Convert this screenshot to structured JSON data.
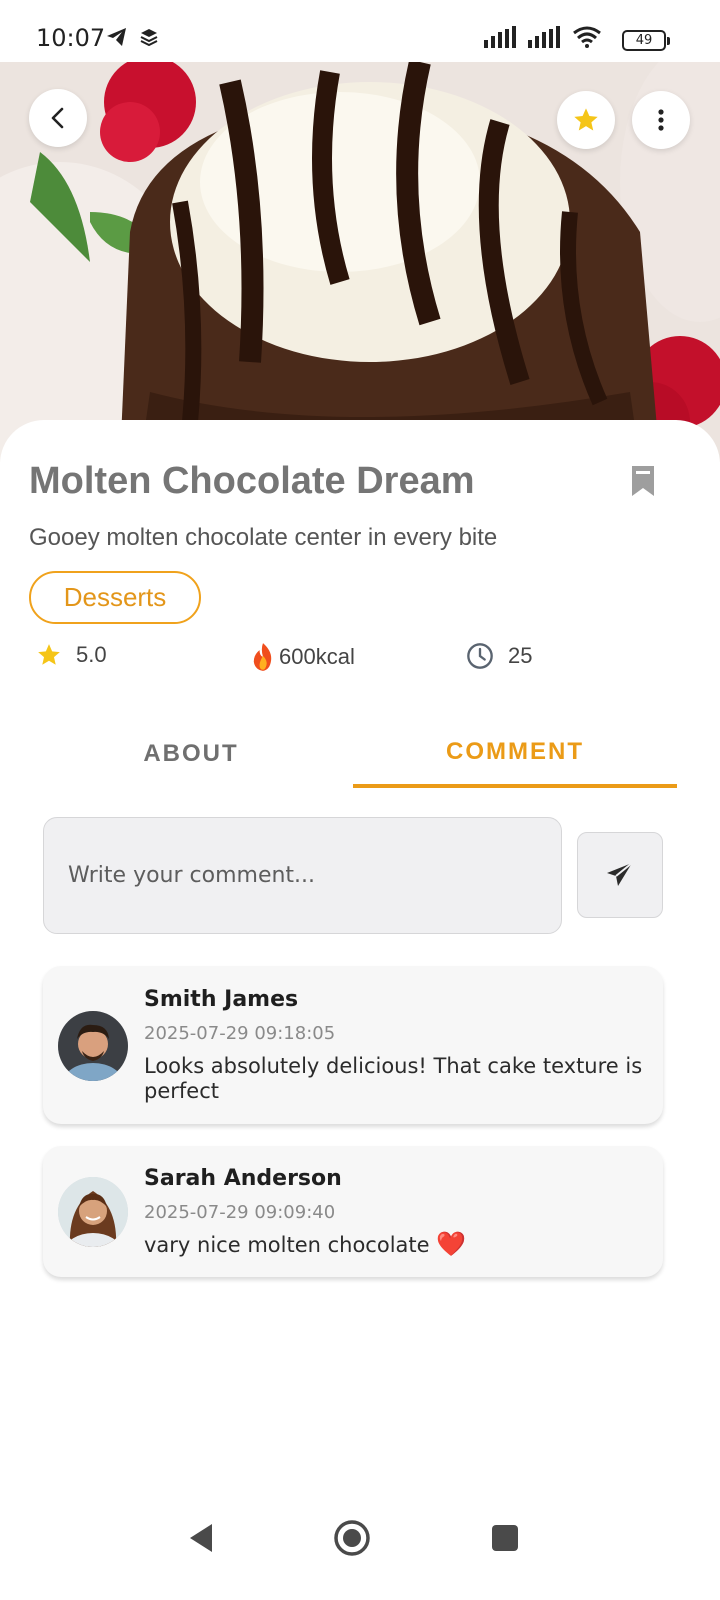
{
  "status_bar": {
    "time": "10:07",
    "battery": "49"
  },
  "hero": {
    "image_alt": "molten chocolate cake with ice cream"
  },
  "recipe": {
    "title": "Molten Chocolate Dream",
    "subtitle": "Gooey molten chocolate center in every bite",
    "category": "Desserts",
    "rating": "5.0",
    "calories": "600kcal",
    "time": "25"
  },
  "tabs": [
    {
      "label": "ABOUT",
      "active": false
    },
    {
      "label": "COMMENT",
      "active": true
    }
  ],
  "comment_input": {
    "placeholder": "Write your comment..."
  },
  "comments": [
    {
      "name": "Smith James",
      "timestamp": "2025-07-29 09:18:05",
      "text": "Looks absolutely delicious! That cake texture is perfect"
    },
    {
      "name": "Sarah Anderson",
      "timestamp": "2025-07-29 09:09:40",
      "text": "vary nice molten chocolate",
      "emoji": "❤️"
    }
  ],
  "colors": {
    "accent": "#eb9b17",
    "title_gray": "#757575",
    "card_bg": "#f7f7f7"
  },
  "icons": [
    "back-icon",
    "star-icon",
    "more-vert-icon",
    "bookmark-icon",
    "fire-icon",
    "clock-icon",
    "send-icon",
    "telegram-icon",
    "layers-icon",
    "signal-icon",
    "wifi-icon",
    "battery-icon"
  ]
}
